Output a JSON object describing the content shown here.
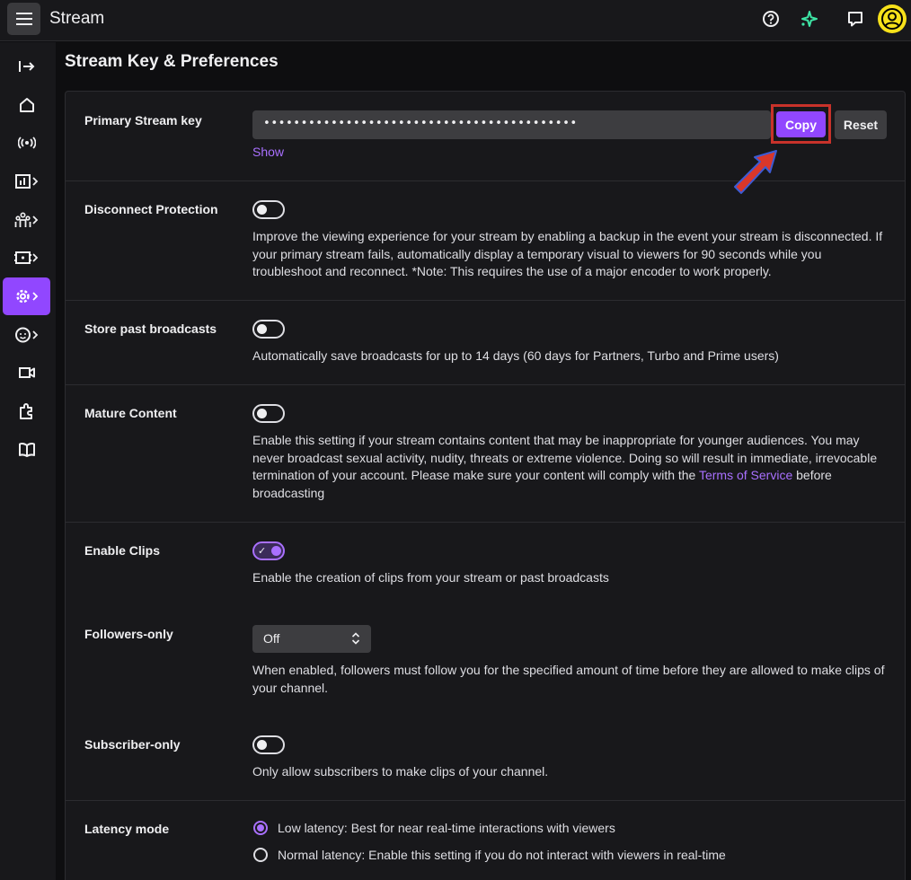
{
  "app": {
    "title": "Stream",
    "brand_color": "#9147ff",
    "link_color": "#a970ff",
    "avatar_color": "#f7e11a"
  },
  "topbar_icons": [
    "menu-icon",
    "help-icon",
    "sparkle-icon",
    "whispers-icon",
    "user-avatar-icon"
  ],
  "sidenav": {
    "items": [
      {
        "name": "collapse-icon"
      },
      {
        "name": "home-icon"
      },
      {
        "name": "stream-icon"
      },
      {
        "name": "analytics-icon"
      },
      {
        "name": "community-icon"
      },
      {
        "name": "content-icon"
      },
      {
        "name": "settings-icon",
        "active": true
      },
      {
        "name": "viewer-icon"
      },
      {
        "name": "camera-icon"
      },
      {
        "name": "extensions-icon"
      },
      {
        "name": "learn-icon"
      }
    ]
  },
  "page": {
    "title": "Stream Key & Preferences"
  },
  "stream_key": {
    "label": "Primary Stream key",
    "masked_value": "••••••••••••••••••••••••••••••••••••••••••",
    "show_label": "Show",
    "copy_label": "Copy",
    "reset_label": "Reset"
  },
  "disconnect_protection": {
    "label": "Disconnect Protection",
    "enabled": false,
    "description": "Improve the viewing experience for your stream by enabling a backup in the event your stream is disconnected. If your primary stream fails, automatically display a temporary visual to viewers for 90 seconds while you troubleshoot and reconnect. *Note: This requires the use of a major encoder to work properly."
  },
  "store_broadcasts": {
    "label": "Store past broadcasts",
    "enabled": false,
    "description": "Automatically save broadcasts for up to 14 days (60 days for Partners, Turbo and Prime users)"
  },
  "mature_content": {
    "label": "Mature Content",
    "enabled": false,
    "description_before": "Enable this setting if your stream contains content that may be inappropriate for younger audiences. You may never broadcast sexual activity, nudity, threats or extreme violence. Doing so will result in immediate, irrevocable termination of your account. Please make sure your content will comply with the ",
    "tos_link": "Terms of Service",
    "description_after": " before broadcasting"
  },
  "clips": {
    "label": "Enable Clips",
    "enabled": true,
    "description": "Enable the creation of clips from your stream or past broadcasts"
  },
  "followers_only": {
    "label": "Followers-only",
    "selected": "Off",
    "description": "When enabled, followers must follow you for the specified amount of time before they are allowed to make clips of your channel."
  },
  "subscriber_only": {
    "label": "Subscriber-only",
    "enabled": false,
    "description": "Only allow subscribers to make clips of your channel."
  },
  "latency": {
    "label": "Latency mode",
    "options": [
      {
        "label": "Low latency: Best for near real-time interactions with viewers",
        "selected": true
      },
      {
        "label": "Normal latency: Enable this setting if you do not interact with viewers in real-time",
        "selected": false
      }
    ]
  }
}
